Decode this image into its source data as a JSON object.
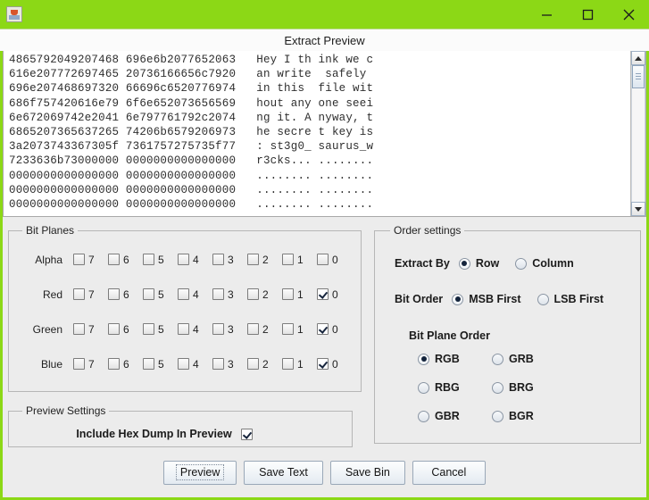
{
  "window": {
    "app_icon": "java-duke-icon",
    "minimize_label": "minimize-icon",
    "maximize_label": "maximize-icon",
    "close_label": "close-icon",
    "accent_color": "#8cd816",
    "panel_color": "#ececec"
  },
  "dialog": {
    "title": "Extract Preview"
  },
  "preview": {
    "lines": [
      {
        "hex1": "4865792049207468",
        "hex2": "696e6b2077652063",
        "ascii1": "Hey I th",
        "ascii2": "ink we c"
      },
      {
        "hex1": "616e207772697465",
        "hex2": "20736166656c7920",
        "ascii1": "an write",
        "ascii2": " safely "
      },
      {
        "hex1": "696e207468697320",
        "hex2": "66696c6520776974",
        "ascii1": "in this ",
        "ascii2": "file wit"
      },
      {
        "hex1": "686f757420616e79",
        "hex2": "6f6e652073656569",
        "ascii1": "hout any",
        "ascii2": "one seei"
      },
      {
        "hex1": "6e672069742e2041",
        "hex2": "6e797761792c2074",
        "ascii1": "ng it. A",
        "ascii2": "nyway, t"
      },
      {
        "hex1": "6865207365637265",
        "hex2": "74206b6579206973",
        "ascii1": "he secre",
        "ascii2": "t key is"
      },
      {
        "hex1": "3a2073743367305f",
        "hex2": "7361757275735f77",
        "ascii1": ": st3g0_",
        "ascii2": "saurus_w"
      },
      {
        "hex1": "7233636b73000000",
        "hex2": "0000000000000000",
        "ascii1": "r3cks...",
        "ascii2": "........"
      },
      {
        "hex1": "0000000000000000",
        "hex2": "0000000000000000",
        "ascii1": "........",
        "ascii2": "........"
      },
      {
        "hex1": "0000000000000000",
        "hex2": "0000000000000000",
        "ascii1": "........",
        "ascii2": "........"
      },
      {
        "hex1": "0000000000000000",
        "hex2": "0000000000000000",
        "ascii1": "........",
        "ascii2": "........"
      }
    ]
  },
  "bit_planes": {
    "legend": "Bit Planes",
    "bits": [
      "7",
      "6",
      "5",
      "4",
      "3",
      "2",
      "1",
      "0"
    ],
    "rows": [
      {
        "channel": "Alpha",
        "checked": [
          false,
          false,
          false,
          false,
          false,
          false,
          false,
          false
        ]
      },
      {
        "channel": "Red",
        "checked": [
          false,
          false,
          false,
          false,
          false,
          false,
          false,
          true
        ]
      },
      {
        "channel": "Green",
        "checked": [
          false,
          false,
          false,
          false,
          false,
          false,
          false,
          true
        ]
      },
      {
        "channel": "Blue",
        "checked": [
          false,
          false,
          false,
          false,
          false,
          false,
          false,
          true
        ]
      }
    ]
  },
  "preview_settings": {
    "legend": "Preview Settings",
    "include_hex_dump_label": "Include Hex Dump In Preview",
    "include_hex_dump_checked": true
  },
  "order_settings": {
    "legend": "Order settings",
    "extract_by": {
      "label": "Extract By",
      "options": [
        "Row",
        "Column"
      ],
      "selected": "Row"
    },
    "bit_order": {
      "label": "Bit Order",
      "options": [
        "MSB First",
        "LSB First"
      ],
      "selected": "MSB First"
    },
    "bit_plane_order": {
      "label": "Bit Plane Order",
      "options": [
        "RGB",
        "GRB",
        "RBG",
        "BRG",
        "GBR",
        "BGR"
      ],
      "selected": "RGB"
    }
  },
  "buttons": {
    "preview": "Preview",
    "save_text": "Save Text",
    "save_bin": "Save Bin",
    "cancel": "Cancel",
    "focused": "Preview"
  }
}
